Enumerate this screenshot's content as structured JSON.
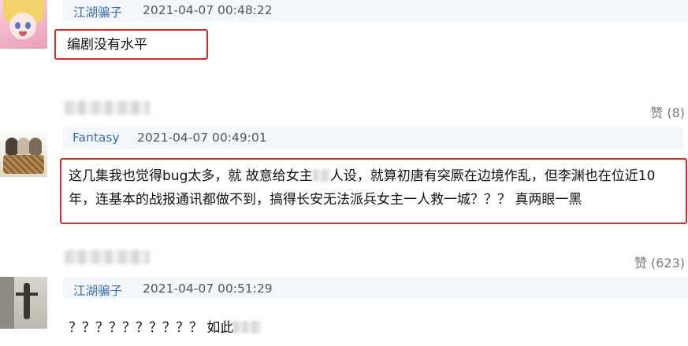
{
  "comments": [
    {
      "username": "江湖骗子",
      "timestamp": "2021-04-07 00:48:22",
      "text": "编剧没有水平",
      "likes": "赞 (8)"
    },
    {
      "username": "Fantasy",
      "timestamp": "2021-04-07 00:49:01",
      "text_part1": "这几集我也觉得bug太多，就 故意给女主",
      "text_part2": "人设，就算初唐有突厥在边境作乱，但李渊也在位近10",
      "text_line2": "年，连基本的战报通讯都做不到，搞得长安无法派兵女主一人救一城？？？ 真两眼一黑",
      "likes": "赞 (623)"
    },
    {
      "username": "江湖骗子",
      "timestamp": "2021-04-07 00:51:29",
      "text": "？？？？？？？？？？ 如此"
    }
  ]
}
